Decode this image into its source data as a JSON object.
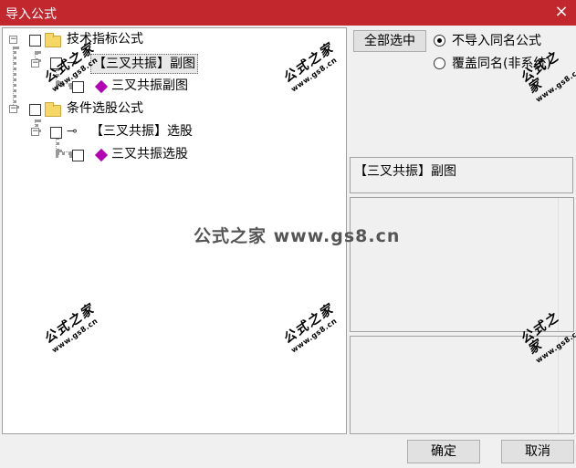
{
  "window": {
    "title": "导入公式",
    "close_glyph": "×"
  },
  "tree": [
    {
      "label": "技术指标公式",
      "expander": "−"
    },
    {
      "label": "【三叉共振】副图",
      "expander": "−",
      "selected": true
    },
    {
      "label": "三叉共振副图"
    },
    {
      "label": "条件选股公式",
      "expander": "−"
    },
    {
      "label": "【三叉共振】选股",
      "expander": "−"
    },
    {
      "label": "三叉共振选股"
    }
  ],
  "buttons": {
    "select_all": "全部选中",
    "ok": "确定",
    "cancel": "取消"
  },
  "options": {
    "no_import": "不导入同名公式",
    "overwrite": "覆盖同名(非系统)",
    "selected": "no_import"
  },
  "description": "【三叉共振】副图",
  "watermark": {
    "text": "公式之家",
    "url": "www.gs8.cn",
    "center": "公式之家 www.gs8.cn"
  },
  "colors": {
    "titlebar": "#c1272d",
    "gem": "#b400b4",
    "folder": "#f6d766"
  }
}
